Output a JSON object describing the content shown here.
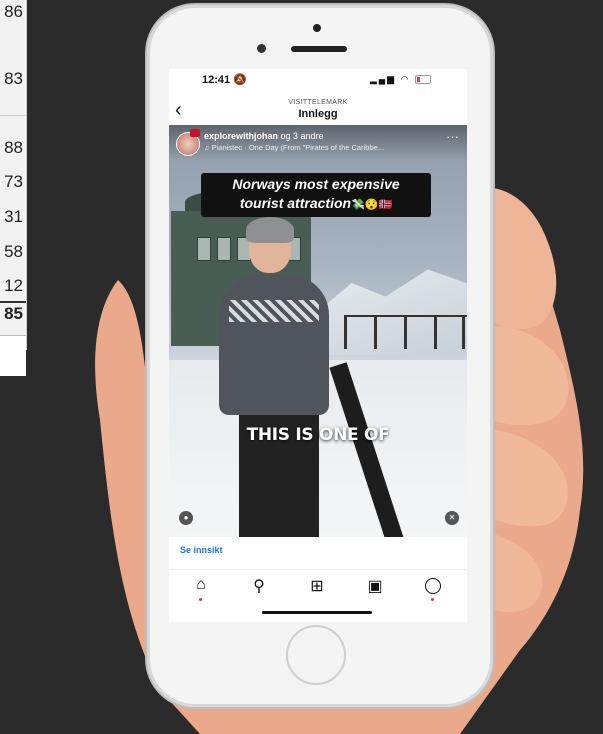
{
  "background_sheet": {
    "values": [
      "86",
      "83",
      "88",
      "73",
      "31",
      "58",
      "12",
      "85"
    ],
    "bold_value_index": 7
  },
  "phone": {
    "status_bar": {
      "time": "12:41",
      "bell_icon": "bell-slash-icon"
    },
    "nav": {
      "subtitle": "VISITTELEMARK",
      "title": "Innlegg",
      "back_icon": "chevron-left-icon"
    },
    "post": {
      "username": "explorewithjohan",
      "coauthors": " og 3 andre",
      "music": "Pianistec · One Day (From \"Pirates of the Caribbe...",
      "caption_line1": "Norways most expensive",
      "caption_line2": "tourist attraction",
      "caption_emojis": "💸😯🇳🇴",
      "subtitle": "THIS IS ONE OF"
    },
    "insight_link": "Se innsikt",
    "tabs": [
      "home",
      "search",
      "create",
      "reels",
      "profile"
    ],
    "colors": {
      "link": "#1877f2",
      "notification": "#e33333"
    }
  }
}
